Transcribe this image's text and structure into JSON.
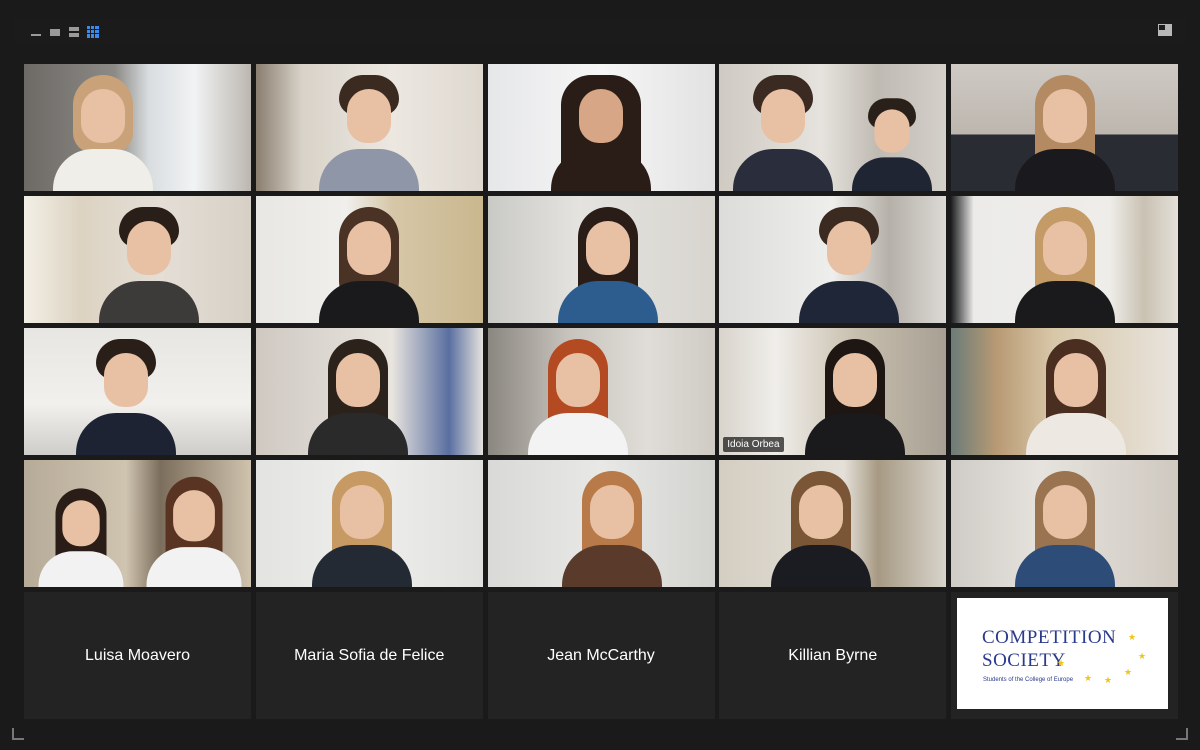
{
  "window": {
    "layout_icons": [
      "minimize-view",
      "speaker-view",
      "strip-view",
      "gallery-view"
    ],
    "fullscreen_icon": "exit-fullscreen-icon"
  },
  "participants": {
    "active_speaker_name": "Idoia Orbea",
    "audio_only": [
      {
        "name": "Luisa Moavero"
      },
      {
        "name": "Maria Sofia de Felice"
      },
      {
        "name": "Jean McCarthy"
      },
      {
        "name": "Killian Byrne"
      }
    ]
  },
  "logo": {
    "line1": "COMPETITION",
    "line2": "SOCIETY",
    "subtitle": "Students of the College of Europe",
    "text_color": "#2a3a8c",
    "star_color": "#f2c318"
  },
  "colors": {
    "active_border": "#c8e05a",
    "background": "#1a1a1a",
    "tile": "#232323",
    "selected_layout": "#3b8af0"
  }
}
